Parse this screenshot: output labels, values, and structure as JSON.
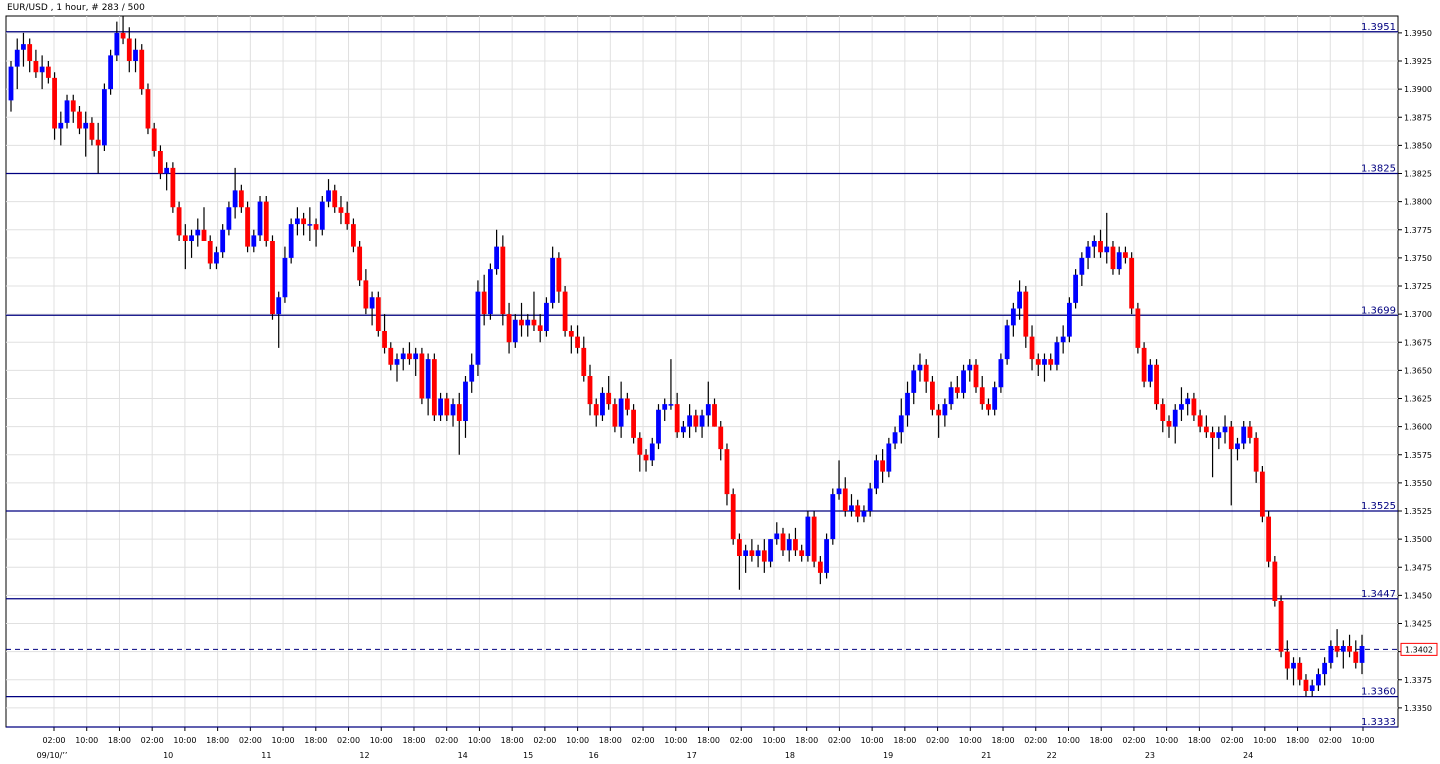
{
  "chart_data": {
    "type": "candlestick",
    "title": "EUR/USD , 1 hour, # 283 / 500",
    "ylim": [
      1.3333,
      1.3965
    ],
    "grid": true,
    "colors": {
      "up": "#0000ff",
      "down": "#ff0000",
      "wick": "#000000",
      "level": "#000080",
      "grid": "#e0e0e0"
    },
    "y_ticks": [
      "1.3350",
      "1.3375",
      "1.3400",
      "1.3425",
      "1.3450",
      "1.3475",
      "1.3500",
      "1.3525",
      "1.3550",
      "1.3575",
      "1.3600",
      "1.3625",
      "1.3650",
      "1.3675",
      "1.3700",
      "1.3725",
      "1.3750",
      "1.3775",
      "1.3800",
      "1.3825",
      "1.3850",
      "1.3875",
      "1.3900",
      "1.3925",
      "1.3950"
    ],
    "x_ticks_top": [
      "02:00",
      "10:00",
      "18:00",
      "02:00",
      "10:00",
      "18:00",
      "02:00",
      "10:00",
      "18:00",
      "02:00",
      "10:00",
      "18:00",
      "02:00",
      "10:00",
      "18:00",
      "02:00",
      "10:00",
      "18:00",
      "02:00",
      "10:00",
      "18:00",
      "02:00",
      "10:00",
      "18:00",
      "02:00",
      "10:00",
      "18:00",
      "02:00",
      "10:00",
      "18:00",
      "02:00",
      "10:00",
      "18:00",
      "02:00",
      "10:00",
      "18:00",
      "02:00",
      "10:00",
      "18:00",
      "02:00",
      "10:00"
    ],
    "x_ticks_bottom": [
      "09/10/’’",
      "10",
      "11",
      "12",
      "14",
      "15",
      "16",
      "17",
      "18",
      "19",
      "21",
      "22",
      "23",
      "24"
    ],
    "levels": [
      {
        "value": 1.3951,
        "label": "1.3951"
      },
      {
        "value": 1.3825,
        "label": "1.3825"
      },
      {
        "value": 1.3699,
        "label": "1.3699"
      },
      {
        "value": 1.3525,
        "label": "1.3525"
      },
      {
        "value": 1.3447,
        "label": "1.3447"
      },
      {
        "value": 1.336,
        "label": "1.3360"
      },
      {
        "value": 1.3333,
        "label": "1.3333"
      }
    ],
    "current": {
      "value": 1.3402,
      "label": "1.3402"
    },
    "candles": [
      [
        1.389,
        1.3925,
        1.388,
        1.392
      ],
      [
        1.392,
        1.3945,
        1.39,
        1.3935
      ],
      [
        1.3935,
        1.395,
        1.392,
        1.394
      ],
      [
        1.394,
        1.3945,
        1.3915,
        1.3925
      ],
      [
        1.3925,
        1.3935,
        1.391,
        1.3915
      ],
      [
        1.3915,
        1.393,
        1.39,
        1.392
      ],
      [
        1.392,
        1.3925,
        1.3905,
        1.391
      ],
      [
        1.391,
        1.3915,
        1.3855,
        1.3865
      ],
      [
        1.3865,
        1.388,
        1.385,
        1.387
      ],
      [
        1.387,
        1.3895,
        1.3865,
        1.389
      ],
      [
        1.389,
        1.3895,
        1.387,
        1.388
      ],
      [
        1.388,
        1.3885,
        1.386,
        1.3865
      ],
      [
        1.3865,
        1.388,
        1.384,
        1.387
      ],
      [
        1.387,
        1.3875,
        1.385,
        1.3855
      ],
      [
        1.3855,
        1.387,
        1.3825,
        1.385
      ],
      [
        1.385,
        1.3905,
        1.3845,
        1.39
      ],
      [
        1.39,
        1.3935,
        1.3895,
        1.393
      ],
      [
        1.393,
        1.396,
        1.3925,
        1.395
      ],
      [
        1.395,
        1.3965,
        1.394,
        1.3945
      ],
      [
        1.3945,
        1.3955,
        1.3915,
        1.3925
      ],
      [
        1.3925,
        1.3945,
        1.3915,
        1.3935
      ],
      [
        1.3935,
        1.394,
        1.3895,
        1.39
      ],
      [
        1.39,
        1.3905,
        1.386,
        1.3865
      ],
      [
        1.3865,
        1.387,
        1.384,
        1.3845
      ],
      [
        1.3845,
        1.385,
        1.382,
        1.3825
      ],
      [
        1.3825,
        1.3835,
        1.381,
        1.383
      ],
      [
        1.383,
        1.3835,
        1.379,
        1.3795
      ],
      [
        1.3795,
        1.38,
        1.3765,
        1.377
      ],
      [
        1.377,
        1.378,
        1.374,
        1.3765
      ],
      [
        1.3765,
        1.3775,
        1.375,
        1.377
      ],
      [
        1.377,
        1.3785,
        1.376,
        1.3775
      ],
      [
        1.3775,
        1.3795,
        1.3765,
        1.3765
      ],
      [
        1.3765,
        1.377,
        1.374,
        1.3745
      ],
      [
        1.3745,
        1.376,
        1.374,
        1.3755
      ],
      [
        1.3755,
        1.378,
        1.375,
        1.3775
      ],
      [
        1.3775,
        1.38,
        1.377,
        1.3795
      ],
      [
        1.3795,
        1.383,
        1.3785,
        1.381
      ],
      [
        1.381,
        1.3815,
        1.379,
        1.3795
      ],
      [
        1.3795,
        1.38,
        1.3755,
        1.376
      ],
      [
        1.376,
        1.3775,
        1.3755,
        1.377
      ],
      [
        1.377,
        1.3805,
        1.3765,
        1.38
      ],
      [
        1.38,
        1.3805,
        1.376,
        1.3765
      ],
      [
        1.3765,
        1.377,
        1.3695,
        1.37
      ],
      [
        1.37,
        1.372,
        1.367,
        1.3715
      ],
      [
        1.3715,
        1.376,
        1.371,
        1.375
      ],
      [
        1.375,
        1.3785,
        1.3745,
        1.378
      ],
      [
        1.378,
        1.3795,
        1.377,
        1.3785
      ],
      [
        1.3785,
        1.379,
        1.377,
        1.378
      ],
      [
        1.378,
        1.3795,
        1.3765,
        1.378
      ],
      [
        1.378,
        1.3785,
        1.376,
        1.3775
      ],
      [
        1.3775,
        1.3805,
        1.377,
        1.38
      ],
      [
        1.38,
        1.382,
        1.3795,
        1.381
      ],
      [
        1.381,
        1.3815,
        1.379,
        1.3795
      ],
      [
        1.3795,
        1.3805,
        1.378,
        1.379
      ],
      [
        1.379,
        1.38,
        1.3775,
        1.378
      ],
      [
        1.378,
        1.3785,
        1.3755,
        1.376
      ],
      [
        1.376,
        1.3765,
        1.3725,
        1.373
      ],
      [
        1.373,
        1.374,
        1.37,
        1.3705
      ],
      [
        1.3705,
        1.372,
        1.369,
        1.3715
      ],
      [
        1.3715,
        1.372,
        1.368,
        1.3685
      ],
      [
        1.3685,
        1.37,
        1.3665,
        1.367
      ],
      [
        1.367,
        1.3675,
        1.365,
        1.3655
      ],
      [
        1.3655,
        1.3665,
        1.364,
        1.366
      ],
      [
        1.366,
        1.367,
        1.365,
        1.3665
      ],
      [
        1.3665,
        1.3675,
        1.3655,
        1.366
      ],
      [
        1.366,
        1.367,
        1.3645,
        1.3665
      ],
      [
        1.3665,
        1.367,
        1.362,
        1.3625
      ],
      [
        1.3625,
        1.3665,
        1.361,
        1.366
      ],
      [
        1.366,
        1.3665,
        1.3605,
        1.361
      ],
      [
        1.361,
        1.363,
        1.3605,
        1.3625
      ],
      [
        1.3625,
        1.363,
        1.3605,
        1.361
      ],
      [
        1.361,
        1.3625,
        1.36,
        1.362
      ],
      [
        1.362,
        1.363,
        1.3575,
        1.3605
      ],
      [
        1.3605,
        1.3645,
        1.359,
        1.364
      ],
      [
        1.364,
        1.3665,
        1.363,
        1.3655
      ],
      [
        1.3655,
        1.373,
        1.3645,
        1.372
      ],
      [
        1.372,
        1.3735,
        1.369,
        1.37
      ],
      [
        1.37,
        1.3745,
        1.3695,
        1.374
      ],
      [
        1.374,
        1.3775,
        1.3735,
        1.376
      ],
      [
        1.376,
        1.377,
        1.369,
        1.37
      ],
      [
        1.37,
        1.371,
        1.3665,
        1.3675
      ],
      [
        1.3675,
        1.37,
        1.367,
        1.3695
      ],
      [
        1.3695,
        1.371,
        1.368,
        1.369
      ],
      [
        1.369,
        1.37,
        1.368,
        1.3695
      ],
      [
        1.3695,
        1.372,
        1.3685,
        1.369
      ],
      [
        1.369,
        1.37,
        1.3675,
        1.3685
      ],
      [
        1.3685,
        1.3715,
        1.368,
        1.371
      ],
      [
        1.371,
        1.376,
        1.3705,
        1.375
      ],
      [
        1.375,
        1.3755,
        1.371,
        1.372
      ],
      [
        1.372,
        1.3725,
        1.368,
        1.3685
      ],
      [
        1.3685,
        1.369,
        1.3665,
        1.368
      ],
      [
        1.368,
        1.369,
        1.3665,
        1.367
      ],
      [
        1.367,
        1.368,
        1.364,
        1.3645
      ],
      [
        1.3645,
        1.3655,
        1.361,
        1.362
      ],
      [
        1.362,
        1.3625,
        1.36,
        1.361
      ],
      [
        1.361,
        1.3635,
        1.3605,
        1.363
      ],
      [
        1.363,
        1.3645,
        1.3615,
        1.362
      ],
      [
        1.362,
        1.3625,
        1.3595,
        1.36
      ],
      [
        1.36,
        1.364,
        1.359,
        1.3625
      ],
      [
        1.3625,
        1.363,
        1.361,
        1.3615
      ],
      [
        1.3615,
        1.362,
        1.3585,
        1.359
      ],
      [
        1.359,
        1.3595,
        1.356,
        1.3575
      ],
      [
        1.3575,
        1.358,
        1.356,
        1.357
      ],
      [
        1.357,
        1.359,
        1.3565,
        1.3585
      ],
      [
        1.3585,
        1.362,
        1.358,
        1.3615
      ],
      [
        1.3615,
        1.3625,
        1.3605,
        1.362
      ],
      [
        1.362,
        1.366,
        1.3615,
        1.362
      ],
      [
        1.362,
        1.363,
        1.359,
        1.3595
      ],
      [
        1.3595,
        1.3605,
        1.359,
        1.36
      ],
      [
        1.36,
        1.362,
        1.359,
        1.361
      ],
      [
        1.361,
        1.3615,
        1.3595,
        1.36
      ],
      [
        1.36,
        1.3615,
        1.359,
        1.361
      ],
      [
        1.361,
        1.364,
        1.36,
        1.362
      ],
      [
        1.362,
        1.3625,
        1.36,
        1.36
      ],
      [
        1.36,
        1.3605,
        1.357,
        1.358
      ],
      [
        1.358,
        1.3585,
        1.353,
        1.354
      ],
      [
        1.354,
        1.3545,
        1.3495,
        1.35
      ],
      [
        1.35,
        1.3505,
        1.3455,
        1.3485
      ],
      [
        1.3485,
        1.3495,
        1.347,
        1.349
      ],
      [
        1.349,
        1.35,
        1.348,
        1.3485
      ],
      [
        1.3485,
        1.3495,
        1.3475,
        1.349
      ],
      [
        1.349,
        1.35,
        1.347,
        1.348
      ],
      [
        1.348,
        1.35,
        1.3475,
        1.35
      ],
      [
        1.35,
        1.3515,
        1.3495,
        1.3505
      ],
      [
        1.3505,
        1.351,
        1.3485,
        1.349
      ],
      [
        1.349,
        1.3505,
        1.348,
        1.35
      ],
      [
        1.35,
        1.351,
        1.3485,
        1.349
      ],
      [
        1.349,
        1.3495,
        1.348,
        1.3485
      ],
      [
        1.3485,
        1.3525,
        1.348,
        1.352
      ],
      [
        1.352,
        1.3525,
        1.3475,
        1.348
      ],
      [
        1.348,
        1.3485,
        1.346,
        1.347
      ],
      [
        1.347,
        1.3505,
        1.3465,
        1.35
      ],
      [
        1.35,
        1.3545,
        1.3495,
        1.354
      ],
      [
        1.354,
        1.357,
        1.3535,
        1.3545
      ],
      [
        1.3545,
        1.3555,
        1.352,
        1.3525
      ],
      [
        1.3525,
        1.354,
        1.352,
        1.353
      ],
      [
        1.353,
        1.3535,
        1.3515,
        1.352
      ],
      [
        1.352,
        1.353,
        1.3515,
        1.3525
      ],
      [
        1.3525,
        1.355,
        1.352,
        1.3545
      ],
      [
        1.3545,
        1.3575,
        1.354,
        1.357
      ],
      [
        1.357,
        1.358,
        1.355,
        1.356
      ],
      [
        1.356,
        1.359,
        1.3555,
        1.3585
      ],
      [
        1.3585,
        1.36,
        1.358,
        1.3595
      ],
      [
        1.3595,
        1.3625,
        1.3585,
        1.361
      ],
      [
        1.361,
        1.364,
        1.36,
        1.363
      ],
      [
        1.363,
        1.3655,
        1.362,
        1.365
      ],
      [
        1.365,
        1.3665,
        1.364,
        1.3655
      ],
      [
        1.3655,
        1.366,
        1.363,
        1.364
      ],
      [
        1.364,
        1.3645,
        1.361,
        1.3615
      ],
      [
        1.3615,
        1.362,
        1.359,
        1.361
      ],
      [
        1.361,
        1.3625,
        1.36,
        1.362
      ],
      [
        1.362,
        1.364,
        1.3615,
        1.3635
      ],
      [
        1.3635,
        1.3645,
        1.3625,
        1.363
      ],
      [
        1.363,
        1.3655,
        1.3625,
        1.365
      ],
      [
        1.365,
        1.366,
        1.364,
        1.3655
      ],
      [
        1.3655,
        1.366,
        1.363,
        1.3635
      ],
      [
        1.3635,
        1.3645,
        1.3615,
        1.362
      ],
      [
        1.362,
        1.3625,
        1.361,
        1.3615
      ],
      [
        1.3615,
        1.364,
        1.361,
        1.3635
      ],
      [
        1.3635,
        1.3665,
        1.363,
        1.366
      ],
      [
        1.366,
        1.3695,
        1.3655,
        1.369
      ],
      [
        1.369,
        1.371,
        1.368,
        1.3705
      ],
      [
        1.3705,
        1.373,
        1.3695,
        1.372
      ],
      [
        1.372,
        1.3725,
        1.367,
        1.368
      ],
      [
        1.368,
        1.369,
        1.365,
        1.366
      ],
      [
        1.366,
        1.3665,
        1.3645,
        1.3655
      ],
      [
        1.3655,
        1.3665,
        1.364,
        1.366
      ],
      [
        1.366,
        1.3665,
        1.365,
        1.3655
      ],
      [
        1.3655,
        1.368,
        1.365,
        1.3675
      ],
      [
        1.3675,
        1.369,
        1.3665,
        1.368
      ],
      [
        1.368,
        1.3715,
        1.3675,
        1.371
      ],
      [
        1.371,
        1.374,
        1.3705,
        1.3735
      ],
      [
        1.3735,
        1.3755,
        1.3725,
        1.375
      ],
      [
        1.375,
        1.3765,
        1.374,
        1.376
      ],
      [
        1.376,
        1.377,
        1.375,
        1.3765
      ],
      [
        1.3765,
        1.3775,
        1.375,
        1.3755
      ],
      [
        1.3755,
        1.379,
        1.3745,
        1.376
      ],
      [
        1.376,
        1.3765,
        1.3735,
        1.374
      ],
      [
        1.374,
        1.376,
        1.3735,
        1.3755
      ],
      [
        1.3755,
        1.376,
        1.3745,
        1.375
      ],
      [
        1.375,
        1.3755,
        1.37,
        1.3705
      ],
      [
        1.3705,
        1.371,
        1.3665,
        1.367
      ],
      [
        1.367,
        1.3675,
        1.3635,
        1.364
      ],
      [
        1.364,
        1.366,
        1.3635,
        1.3655
      ],
      [
        1.3655,
        1.366,
        1.3615,
        1.362
      ],
      [
        1.362,
        1.3625,
        1.3595,
        1.3605
      ],
      [
        1.3605,
        1.361,
        1.359,
        1.36
      ],
      [
        1.36,
        1.362,
        1.3585,
        1.3615
      ],
      [
        1.3615,
        1.3635,
        1.3605,
        1.362
      ],
      [
        1.362,
        1.363,
        1.361,
        1.3625
      ],
      [
        1.3625,
        1.363,
        1.3605,
        1.361
      ],
      [
        1.361,
        1.3615,
        1.3595,
        1.36
      ],
      [
        1.36,
        1.361,
        1.359,
        1.3595
      ],
      [
        1.3595,
        1.36,
        1.3555,
        1.359
      ],
      [
        1.359,
        1.36,
        1.358,
        1.3595
      ],
      [
        1.3595,
        1.361,
        1.3585,
        1.36
      ],
      [
        1.36,
        1.3605,
        1.353,
        1.358
      ],
      [
        1.358,
        1.359,
        1.357,
        1.3585
      ],
      [
        1.3585,
        1.3605,
        1.358,
        1.36
      ],
      [
        1.36,
        1.3605,
        1.3585,
        1.359
      ],
      [
        1.359,
        1.3595,
        1.355,
        1.356
      ],
      [
        1.356,
        1.3565,
        1.3515,
        1.352
      ],
      [
        1.352,
        1.3525,
        1.3475,
        1.348
      ],
      [
        1.348,
        1.3485,
        1.344,
        1.3445
      ],
      [
        1.3445,
        1.345,
        1.3395,
        1.34
      ],
      [
        1.34,
        1.341,
        1.3375,
        1.3385
      ],
      [
        1.3385,
        1.3395,
        1.337,
        1.339
      ],
      [
        1.339,
        1.3395,
        1.337,
        1.3375
      ],
      [
        1.3375,
        1.338,
        1.336,
        1.3365
      ],
      [
        1.3365,
        1.3375,
        1.336,
        1.337
      ],
      [
        1.337,
        1.3385,
        1.3365,
        1.338
      ],
      [
        1.338,
        1.3395,
        1.337,
        1.339
      ],
      [
        1.339,
        1.341,
        1.3385,
        1.3405
      ],
      [
        1.3405,
        1.342,
        1.3395,
        1.34
      ],
      [
        1.34,
        1.341,
        1.3385,
        1.3405
      ],
      [
        1.3405,
        1.3415,
        1.3395,
        1.34
      ],
      [
        1.34,
        1.341,
        1.3385,
        1.339
      ],
      [
        1.339,
        1.3415,
        1.338,
        1.3405
      ]
    ]
  }
}
